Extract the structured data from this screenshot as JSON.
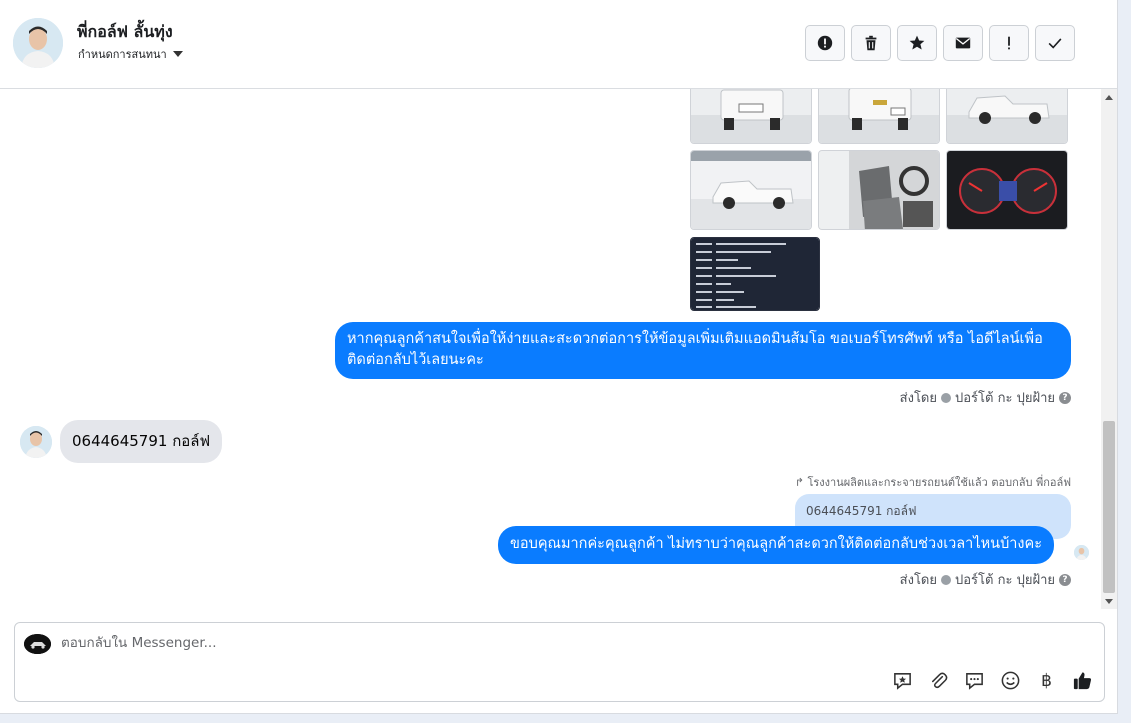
{
  "header": {
    "contact_name": "พี่กอล์ฟ ลั้นทุ่ง",
    "assign_label": "กำหนดการสนทนา",
    "actions": [
      "alert-icon",
      "trash-icon",
      "star-icon",
      "mail-icon",
      "exclamation-icon",
      "check-icon"
    ]
  },
  "messages": {
    "agent_message_1": "หากคุณลูกค้าสนใจเพื่อให้ง่ายและสะดวกต่อการให้ข้อมูลเพิ่มเติมแอดมินส้มโอ ขอเบอร์โทรศัพท์ หรือ ไอดีไลน์เพื่อติดต่อกลับไว้เลยนะคะ",
    "sent_by_label": "ส่งโดย",
    "sent_by_name_1": "ปอร์โต้ กะ ปุยฝ้าย",
    "customer_message": "0644645791 กอล์ฟ",
    "reply_note": "โรงงานผลิตและกระจายรถยนต์ใช้แล้ว ตอบกลับ พี่กอล์ฟ",
    "quoted_text": "0644645791 กอล์ฟ",
    "agent_message_2": "ขอบคุณมากค่ะคุณลูกค้า ไม่ทราบว่าคุณลูกค้าสะดวกให้ติดต่อกลับช่วงเวลาไหนบ้างคะ",
    "sent_by_name_2": "ปอร์โต้ กะ ปุยฝ้าย"
  },
  "composer": {
    "placeholder": "ตอบกลับใน Messenger...",
    "tools": [
      "sticker-icon",
      "attachment-icon",
      "saved-reply-icon",
      "emoji-icon",
      "baht-icon",
      "like-icon"
    ],
    "baht_symbol": "฿"
  },
  "colors": {
    "accent": "#0a7cff",
    "quoted_bg": "#cfe3fb",
    "incoming_bg": "#e4e6eb"
  }
}
